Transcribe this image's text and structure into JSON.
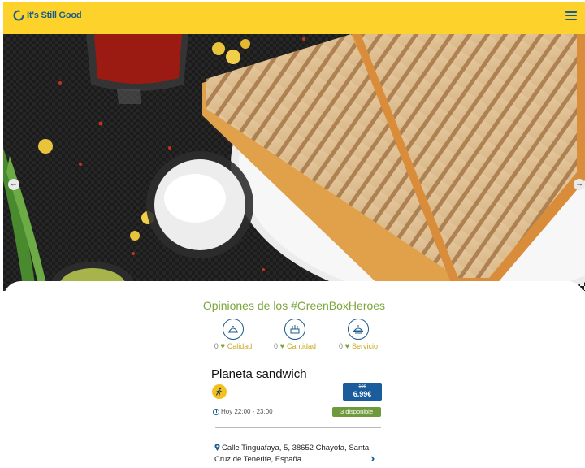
{
  "header": {
    "app_name": "It's Still Good",
    "logo_icon": "circle-arrow-icon",
    "menu_icon": "hamburger-menu-icon",
    "background_color": "#fdd22b",
    "brand_color": "#1a5c8c"
  },
  "carousel": {
    "prev_icon": "arrow-left-icon",
    "next_icon": "arrow-right-icon",
    "prev_glyph": "←",
    "next_glyph": "→"
  },
  "reviews": {
    "title": "Opiniones de los #GreenBoxHeroes",
    "title_color": "#7aa63a",
    "items": [
      {
        "count": "0",
        "label": "Calidad",
        "icon": "quality-icon"
      },
      {
        "count": "0",
        "label": "Cantidad",
        "icon": "quantity-icon"
      },
      {
        "count": "0",
        "label": "Servicio",
        "icon": "service-icon"
      }
    ],
    "heart_glyph": "♥"
  },
  "store": {
    "name": "Planeta sandwich",
    "pickup_icon": "runner-icon",
    "old_price": "10€",
    "price": "6.99€",
    "pickup_time": "Hoy 22:00 - 23:00",
    "availability": "3 disponible",
    "address": "Calle Tinguafaya, 5, 38652 Chayofa, Santa Cruz de Tenerife, España",
    "location_icon": "map-pin-icon",
    "chevron_glyph": "›",
    "accent_green": "#6e9a3c",
    "price_color": "#1a5c9c"
  }
}
